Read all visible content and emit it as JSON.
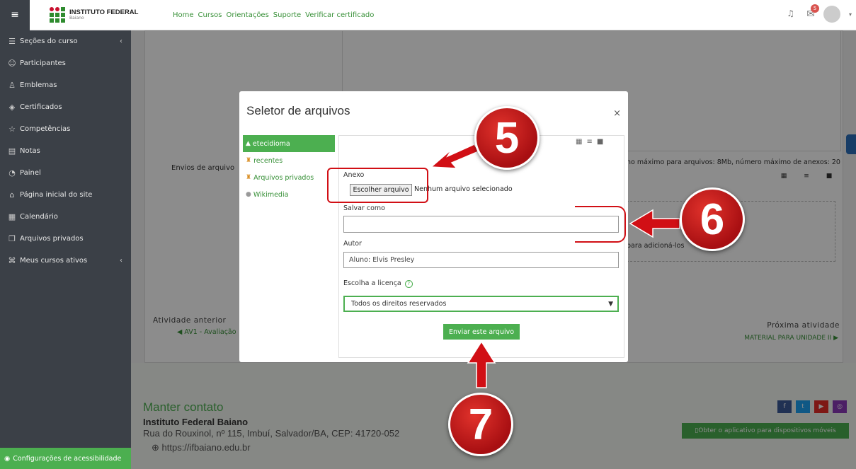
{
  "topbar": {
    "logo_title": "INSTITUTO FEDERAL",
    "logo_sub": "Baiano",
    "nav": [
      "Home",
      "Cursos",
      "Orientações",
      "Suporte",
      "Verificar certificado"
    ],
    "notif_count": "5"
  },
  "sidebar": {
    "items": [
      {
        "label": "Seções do curso",
        "icon": "list-icon"
      },
      {
        "label": "Participantes",
        "icon": "users-icon"
      },
      {
        "label": "Emblemas",
        "icon": "badge-icon"
      },
      {
        "label": "Certificados",
        "icon": "certificate-icon"
      },
      {
        "label": "Competências",
        "icon": "star-icon"
      },
      {
        "label": "Notas",
        "icon": "grades-icon"
      },
      {
        "label": "Painel",
        "icon": "dashboard-icon"
      },
      {
        "label": "Página inicial do site",
        "icon": "home-icon"
      },
      {
        "label": "Calendário",
        "icon": "calendar-icon"
      },
      {
        "label": "Arquivos privados",
        "icon": "files-icon"
      },
      {
        "label": "Meus cursos ativos",
        "icon": "courses-icon"
      }
    ],
    "footer": "Configurações de acessibilidade"
  },
  "page": {
    "envios_label": "Envios de arquivo",
    "limit_text": "ho máximo para arquivos: 8Mb, número máximo de anexos: 20",
    "drop_text": "para adicioná-los",
    "prev_title": "Atividade anterior",
    "prev_link": "◀ AV1 - Avaliação",
    "next_title": "Próxima atividade",
    "next_link": "MATERIAL PARA UNIDADE II ▶"
  },
  "footer": {
    "contact_title": "Manter contato",
    "institution": "Instituto Federal Baiano",
    "address": "Rua do Rouxinol, nº 115, Imbuí, Salvador/BA, CEP: 41720-052",
    "website": "https://ifbaiano.edu.br",
    "app_button": "Obter o aplicativo para dispositivos móveis"
  },
  "modal": {
    "title": "Seletor de arquivos",
    "repos": [
      "etecidioma",
      "recentes",
      "Arquivos privados",
      "Wikimedia"
    ],
    "anexo_label": "Anexo",
    "choose_file": "Escolher arquivo",
    "no_file": "Nenhum arquivo selecionado",
    "save_as_label": "Salvar como",
    "save_as_value": "",
    "author_label": "Autor",
    "author_value": "Aluno: Elvis Presley",
    "license_label": "Escolha a licença",
    "license_value": "Todos os direitos reservados",
    "submit": "Enviar este arquivo"
  },
  "annotations": {
    "step5": "5",
    "step6": "6",
    "step7": "7"
  },
  "colors": {
    "accent": "#4caf50",
    "sidebar": "#3b4047",
    "annotation": "#d10f15"
  }
}
